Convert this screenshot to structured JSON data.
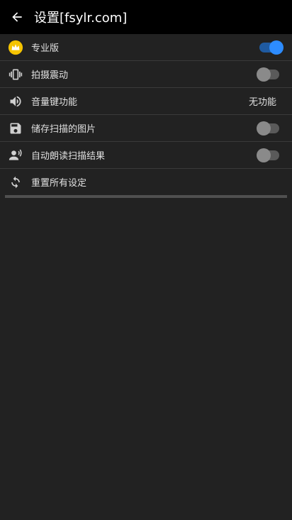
{
  "appbar": {
    "title": "设置[fsylr.com]"
  },
  "settings": [
    {
      "label": "专业版",
      "icon": "crown-icon",
      "control": "toggle",
      "state": true
    },
    {
      "label": "拍摄震动",
      "icon": "vibration-icon",
      "control": "toggle",
      "state": false
    },
    {
      "label": "音量键功能",
      "icon": "volume-icon",
      "control": "value",
      "value": "无功能"
    },
    {
      "label": "储存扫描的图片",
      "icon": "save-icon",
      "control": "toggle",
      "state": false
    },
    {
      "label": "自动朗读扫描结果",
      "icon": "speak-icon",
      "control": "toggle",
      "state": false
    },
    {
      "label": "重置所有设定",
      "icon": "reset-icon",
      "control": "none"
    }
  ],
  "colors": {
    "accent": "#2d8cff",
    "crown": "#f5c400"
  }
}
